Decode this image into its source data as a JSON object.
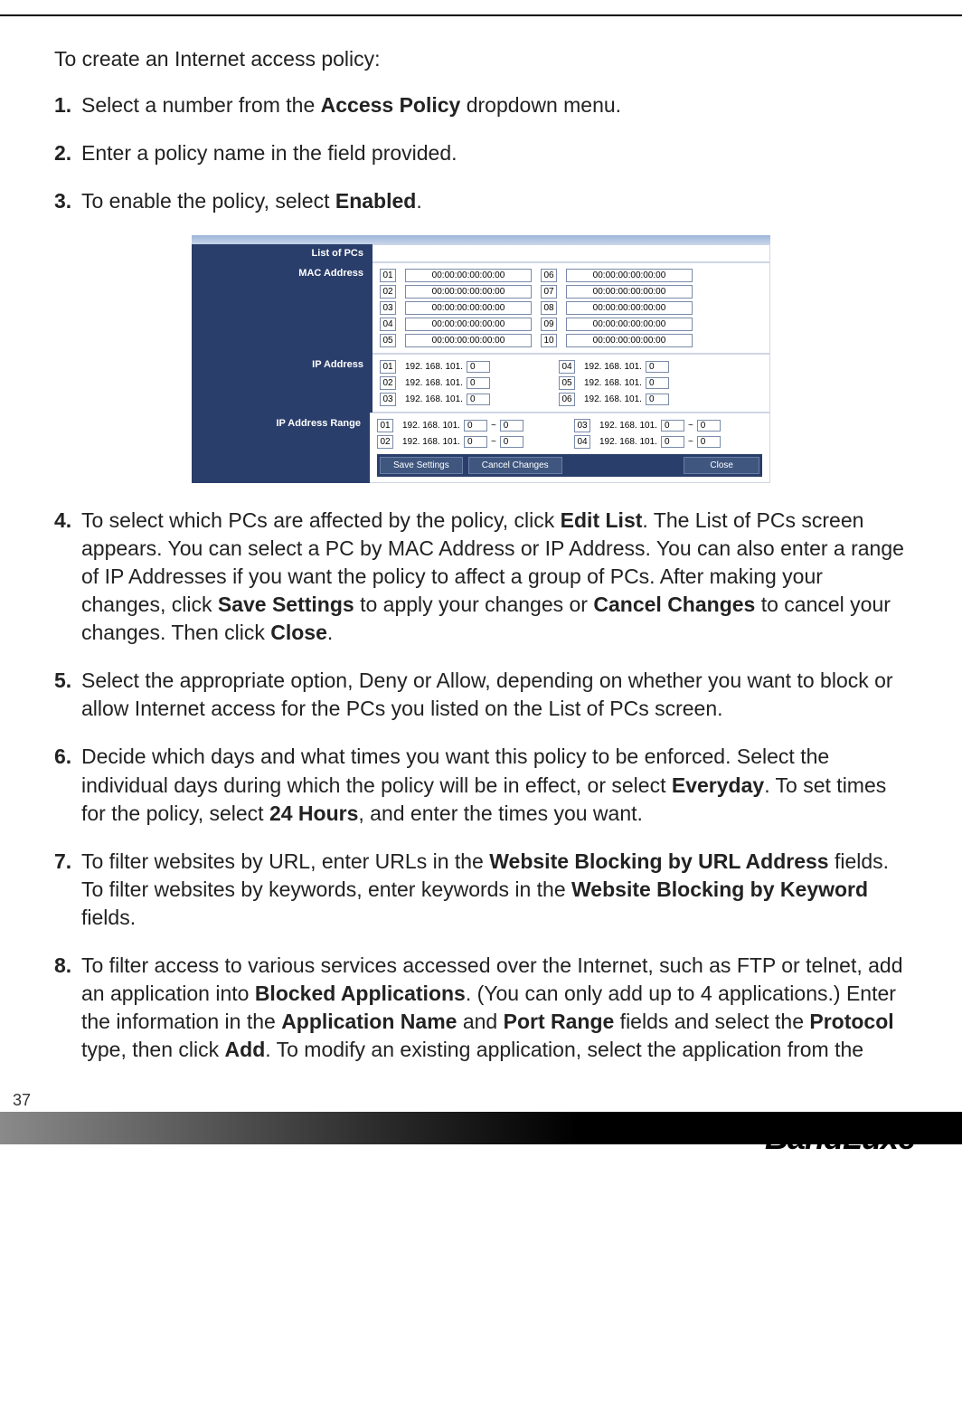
{
  "intro": "To create an Internet access policy:",
  "steps": {
    "s1_pre": "Select a number from the ",
    "s1_b1": "Access Policy",
    "s1_post": " dropdown menu.",
    "s2": "Enter a policy name in the field provided.",
    "s3_pre": "To enable the policy, select ",
    "s3_b1": "Enabled",
    "s3_post": ".",
    "s4_pre": "To select which PCs are affected by the policy, click ",
    "s4_b1": "Edit List",
    "s4_mid1": ". The List of PCs screen appears. You can select a PC by MAC Address or IP Address. You can also enter a range of IP Addresses if you want the policy to affect a group of PCs. After making your changes, click ",
    "s4_b2": "Save Settings",
    "s4_mid2": " to apply your changes or ",
    "s4_b3": "Cancel Changes",
    "s4_mid3": " to cancel your changes. Then click ",
    "s4_b4": "Close",
    "s4_post": ".",
    "s5": "Select the appropriate option, Deny or Allow, depending on whether you want to block or allow Internet access for the PCs you listed on the List of PCs screen.",
    "s6_pre": "Decide which days and what times you want this policy to be enforced. Select the individual days during which the policy will be in effect, or select ",
    "s6_b1": "Everyday",
    "s6_mid1": ". To set times for the policy, select ",
    "s6_b2": "24 Hours",
    "s6_post": ", and enter the times you want.",
    "s7_pre": "To filter websites by URL, enter URLs in the ",
    "s7_b1": "Website Blocking by URL Address",
    "s7_mid1": " fields. To filter websites by keywords, enter keywords in the ",
    "s7_b2": "Website Blocking by Keyword",
    "s7_post": " fields.",
    "s8_pre": "To filter access to various services accessed over the Internet, such as FTP or telnet, add an application into ",
    "s8_b1": "Blocked Applications",
    "s8_mid1": ". (You can only add up to 4 applications.) Enter the information in the ",
    "s8_b2": "Application Name",
    "s8_mid2": " and ",
    "s8_b3": "Port Range",
    "s8_mid3": " fields and select the ",
    "s8_b4": "Protocol",
    "s8_mid4": " type, then click ",
    "s8_b5": "Add",
    "s8_post": ". To modify an existing application, select the application from the"
  },
  "fig": {
    "list_of_pcs": "List of PCs",
    "mac_label": "MAC Address",
    "ip_label": "IP Address",
    "range_label": "IP Address Range",
    "mac_rows": [
      {
        "a_idx": "01",
        "a_val": "00:00:00:00:00:00",
        "b_idx": "06",
        "b_val": "00:00:00:00:00:00"
      },
      {
        "a_idx": "02",
        "a_val": "00:00:00:00:00:00",
        "b_idx": "07",
        "b_val": "00:00:00:00:00:00"
      },
      {
        "a_idx": "03",
        "a_val": "00:00:00:00:00:00",
        "b_idx": "08",
        "b_val": "00:00:00:00:00:00"
      },
      {
        "a_idx": "04",
        "a_val": "00:00:00:00:00:00",
        "b_idx": "09",
        "b_val": "00:00:00:00:00:00"
      },
      {
        "a_idx": "05",
        "a_val": "00:00:00:00:00:00",
        "b_idx": "10",
        "b_val": "00:00:00:00:00:00"
      }
    ],
    "ip_prefix": "192. 168. 101.",
    "ip_rows": [
      {
        "a_idx": "01",
        "a_val": "0",
        "b_idx": "04",
        "b_val": "0"
      },
      {
        "a_idx": "02",
        "a_val": "0",
        "b_idx": "05",
        "b_val": "0"
      },
      {
        "a_idx": "03",
        "a_val": "0",
        "b_idx": "06",
        "b_val": "0"
      }
    ],
    "range_sep": "~",
    "range_rows": [
      {
        "a_idx": "01",
        "a_lo": "0",
        "a_hi": "0",
        "b_idx": "03",
        "b_lo": "0",
        "b_hi": "0"
      },
      {
        "a_idx": "02",
        "a_lo": "0",
        "a_hi": "0",
        "b_idx": "04",
        "b_lo": "0",
        "b_hi": "0"
      }
    ],
    "buttons": {
      "save": "Save Settings",
      "cancel": "Cancel Changes",
      "close": "Close"
    }
  },
  "footer": {
    "page": "37",
    "brand": "BandLuxe",
    "tm": "™"
  }
}
